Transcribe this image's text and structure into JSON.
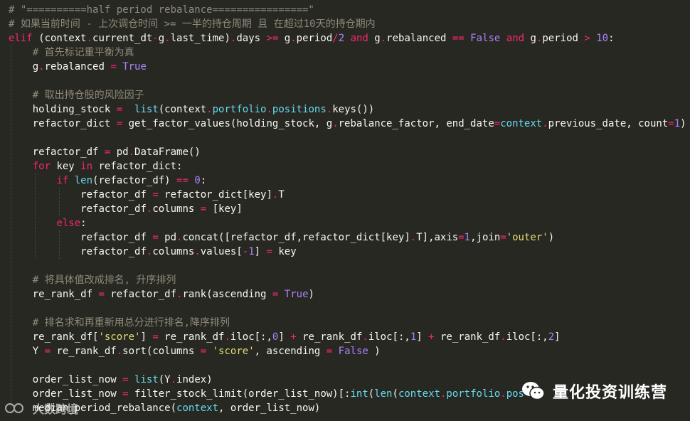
{
  "code_lines": [
    {
      "indent": "",
      "tokens": [
        {
          "c": "cm",
          "t": "# \"==========half period rebalance================\""
        }
      ]
    },
    {
      "indent": "",
      "tokens": [
        {
          "c": "cm",
          "t": "# 如果当前时间 - 上次调仓时间 >= 一半的持仓周期 且 在超过10天的持仓期内"
        }
      ]
    },
    {
      "indent": "",
      "tokens": [
        {
          "c": "kw",
          "t": "elif"
        },
        {
          "c": "tx",
          "t": " (context"
        },
        {
          "c": "op",
          "t": "."
        },
        {
          "c": "tx",
          "t": "current_dt"
        },
        {
          "c": "op",
          "t": "-"
        },
        {
          "c": "tx",
          "t": "g"
        },
        {
          "c": "op",
          "t": "."
        },
        {
          "c": "tx",
          "t": "last_time)"
        },
        {
          "c": "op",
          "t": "."
        },
        {
          "c": "tx",
          "t": "days "
        },
        {
          "c": "op",
          "t": ">="
        },
        {
          "c": "tx",
          "t": " g"
        },
        {
          "c": "op",
          "t": "."
        },
        {
          "c": "tx",
          "t": "period"
        },
        {
          "c": "op",
          "t": "/"
        },
        {
          "c": "nm",
          "t": "2"
        },
        {
          "c": "tx",
          "t": " "
        },
        {
          "c": "kw",
          "t": "and"
        },
        {
          "c": "tx",
          "t": " g"
        },
        {
          "c": "op",
          "t": "."
        },
        {
          "c": "tx",
          "t": "rebalanced "
        },
        {
          "c": "op",
          "t": "=="
        },
        {
          "c": "tx",
          "t": " "
        },
        {
          "c": "cn",
          "t": "False"
        },
        {
          "c": "tx",
          "t": " "
        },
        {
          "c": "kw",
          "t": "and"
        },
        {
          "c": "tx",
          "t": " g"
        },
        {
          "c": "op",
          "t": "."
        },
        {
          "c": "tx",
          "t": "period "
        },
        {
          "c": "op",
          "t": ">"
        },
        {
          "c": "tx",
          "t": " "
        },
        {
          "c": "nm",
          "t": "10"
        },
        {
          "c": "tx",
          "t": ":"
        }
      ]
    },
    {
      "indent": "    ",
      "tokens": [
        {
          "c": "cm",
          "t": "# 首先标记重平衡为真"
        }
      ]
    },
    {
      "indent": "    ",
      "tokens": [
        {
          "c": "tx",
          "t": "g"
        },
        {
          "c": "op",
          "t": "."
        },
        {
          "c": "tx",
          "t": "rebalanced "
        },
        {
          "c": "op",
          "t": "="
        },
        {
          "c": "tx",
          "t": " "
        },
        {
          "c": "cn",
          "t": "True"
        }
      ]
    },
    {
      "indent": "",
      "tokens": []
    },
    {
      "indent": "    ",
      "tokens": [
        {
          "c": "cm",
          "t": "# 取出持仓股的风险因子"
        }
      ]
    },
    {
      "indent": "    ",
      "tokens": [
        {
          "c": "tx",
          "t": "holding_stock "
        },
        {
          "c": "op",
          "t": "="
        },
        {
          "c": "tx",
          "t": "  "
        },
        {
          "c": "bi",
          "t": "list"
        },
        {
          "c": "tx",
          "t": "(context"
        },
        {
          "c": "op",
          "t": "."
        },
        {
          "c": "bi",
          "t": "portfolio"
        },
        {
          "c": "op",
          "t": "."
        },
        {
          "c": "bi",
          "t": "positions"
        },
        {
          "c": "op",
          "t": "."
        },
        {
          "c": "tx",
          "t": "keys())"
        }
      ]
    },
    {
      "indent": "    ",
      "tokens": [
        {
          "c": "tx",
          "t": "refactor_dict "
        },
        {
          "c": "op",
          "t": "="
        },
        {
          "c": "tx",
          "t": " get_factor_values(holding_stock, g"
        },
        {
          "c": "op",
          "t": "."
        },
        {
          "c": "tx",
          "t": "rebalance_factor, end_date"
        },
        {
          "c": "op",
          "t": "="
        },
        {
          "c": "bi",
          "t": "context"
        },
        {
          "c": "op",
          "t": "."
        },
        {
          "c": "tx",
          "t": "previous_date, count"
        },
        {
          "c": "op",
          "t": "="
        },
        {
          "c": "nm",
          "t": "1"
        },
        {
          "c": "tx",
          "t": ")"
        }
      ]
    },
    {
      "indent": "",
      "tokens": []
    },
    {
      "indent": "    ",
      "tokens": [
        {
          "c": "tx",
          "t": "refactor_df "
        },
        {
          "c": "op",
          "t": "="
        },
        {
          "c": "tx",
          "t": " pd"
        },
        {
          "c": "op",
          "t": "."
        },
        {
          "c": "tx",
          "t": "DataFrame()"
        }
      ]
    },
    {
      "indent": "    ",
      "tokens": [
        {
          "c": "kw",
          "t": "for"
        },
        {
          "c": "tx",
          "t": " key "
        },
        {
          "c": "kw",
          "t": "in"
        },
        {
          "c": "tx",
          "t": " refactor_dict:"
        }
      ]
    },
    {
      "indent": "        ",
      "tokens": [
        {
          "c": "kw",
          "t": "if"
        },
        {
          "c": "tx",
          "t": " "
        },
        {
          "c": "bi",
          "t": "len"
        },
        {
          "c": "tx",
          "t": "(refactor_df) "
        },
        {
          "c": "op",
          "t": "=="
        },
        {
          "c": "tx",
          "t": " "
        },
        {
          "c": "nm",
          "t": "0"
        },
        {
          "c": "tx",
          "t": ":"
        }
      ]
    },
    {
      "indent": "            ",
      "tokens": [
        {
          "c": "tx",
          "t": "refactor_df "
        },
        {
          "c": "op",
          "t": "="
        },
        {
          "c": "tx",
          "t": " refactor_dict[key]"
        },
        {
          "c": "op",
          "t": "."
        },
        {
          "c": "tx",
          "t": "T"
        }
      ]
    },
    {
      "indent": "            ",
      "tokens": [
        {
          "c": "tx",
          "t": "refactor_df"
        },
        {
          "c": "op",
          "t": "."
        },
        {
          "c": "tx",
          "t": "columns "
        },
        {
          "c": "op",
          "t": "="
        },
        {
          "c": "tx",
          "t": " [key]"
        }
      ]
    },
    {
      "indent": "        ",
      "tokens": [
        {
          "c": "kw",
          "t": "else"
        },
        {
          "c": "tx",
          "t": ":"
        }
      ]
    },
    {
      "indent": "            ",
      "tokens": [
        {
          "c": "tx",
          "t": "refactor_df "
        },
        {
          "c": "op",
          "t": "="
        },
        {
          "c": "tx",
          "t": " pd"
        },
        {
          "c": "op",
          "t": "."
        },
        {
          "c": "tx",
          "t": "concat([refactor_df,refactor_dict[key]"
        },
        {
          "c": "op",
          "t": "."
        },
        {
          "c": "tx",
          "t": "T],axis"
        },
        {
          "c": "op",
          "t": "="
        },
        {
          "c": "nm",
          "t": "1"
        },
        {
          "c": "tx",
          "t": ",join"
        },
        {
          "c": "op",
          "t": "="
        },
        {
          "c": "st",
          "t": "'outer'"
        },
        {
          "c": "tx",
          "t": ")"
        }
      ]
    },
    {
      "indent": "            ",
      "tokens": [
        {
          "c": "tx",
          "t": "refactor_df"
        },
        {
          "c": "op",
          "t": "."
        },
        {
          "c": "tx",
          "t": "columns"
        },
        {
          "c": "op",
          "t": "."
        },
        {
          "c": "tx",
          "t": "values["
        },
        {
          "c": "op",
          "t": "-"
        },
        {
          "c": "nm",
          "t": "1"
        },
        {
          "c": "tx",
          "t": "] "
        },
        {
          "c": "op",
          "t": "="
        },
        {
          "c": "tx",
          "t": " key"
        }
      ]
    },
    {
      "indent": "",
      "tokens": []
    },
    {
      "indent": "    ",
      "tokens": [
        {
          "c": "cm",
          "t": "# 将具体值改成排名, 升序排列"
        }
      ]
    },
    {
      "indent": "    ",
      "tokens": [
        {
          "c": "tx",
          "t": "re_rank_df "
        },
        {
          "c": "op",
          "t": "="
        },
        {
          "c": "tx",
          "t": " refactor_df"
        },
        {
          "c": "op",
          "t": "."
        },
        {
          "c": "tx",
          "t": "rank(ascending "
        },
        {
          "c": "op",
          "t": "="
        },
        {
          "c": "tx",
          "t": " "
        },
        {
          "c": "cn",
          "t": "True"
        },
        {
          "c": "tx",
          "t": ")"
        }
      ]
    },
    {
      "indent": "",
      "tokens": []
    },
    {
      "indent": "    ",
      "tokens": [
        {
          "c": "cm",
          "t": "# 排名求和再重新用总分进行排名,降序排列"
        }
      ]
    },
    {
      "indent": "    ",
      "tokens": [
        {
          "c": "tx",
          "t": "re_rank_df["
        },
        {
          "c": "st",
          "t": "'score'"
        },
        {
          "c": "tx",
          "t": "] "
        },
        {
          "c": "op",
          "t": "="
        },
        {
          "c": "tx",
          "t": " re_rank_df"
        },
        {
          "c": "op",
          "t": "."
        },
        {
          "c": "tx",
          "t": "iloc[:,"
        },
        {
          "c": "nm",
          "t": "0"
        },
        {
          "c": "tx",
          "t": "] "
        },
        {
          "c": "op",
          "t": "+"
        },
        {
          "c": "tx",
          "t": " re_rank_df"
        },
        {
          "c": "op",
          "t": "."
        },
        {
          "c": "tx",
          "t": "iloc[:,"
        },
        {
          "c": "nm",
          "t": "1"
        },
        {
          "c": "tx",
          "t": "] "
        },
        {
          "c": "op",
          "t": "+"
        },
        {
          "c": "tx",
          "t": " re_rank_df"
        },
        {
          "c": "op",
          "t": "."
        },
        {
          "c": "tx",
          "t": "iloc[:,"
        },
        {
          "c": "nm",
          "t": "2"
        },
        {
          "c": "tx",
          "t": "]"
        }
      ]
    },
    {
      "indent": "    ",
      "tokens": [
        {
          "c": "tx",
          "t": "Y "
        },
        {
          "c": "op",
          "t": "="
        },
        {
          "c": "tx",
          "t": " re_rank_df"
        },
        {
          "c": "op",
          "t": "."
        },
        {
          "c": "tx",
          "t": "sort(columns "
        },
        {
          "c": "op",
          "t": "="
        },
        {
          "c": "tx",
          "t": " "
        },
        {
          "c": "st",
          "t": "'score'"
        },
        {
          "c": "tx",
          "t": ", ascending "
        },
        {
          "c": "op",
          "t": "="
        },
        {
          "c": "tx",
          "t": " "
        },
        {
          "c": "cn",
          "t": "False"
        },
        {
          "c": "tx",
          "t": " )"
        }
      ]
    },
    {
      "indent": "",
      "tokens": []
    },
    {
      "indent": "    ",
      "tokens": [
        {
          "c": "tx",
          "t": "order_list_now "
        },
        {
          "c": "op",
          "t": "="
        },
        {
          "c": "tx",
          "t": " "
        },
        {
          "c": "bi",
          "t": "list"
        },
        {
          "c": "tx",
          "t": "(Y"
        },
        {
          "c": "op",
          "t": "."
        },
        {
          "c": "tx",
          "t": "index)"
        }
      ]
    },
    {
      "indent": "    ",
      "tokens": [
        {
          "c": "tx",
          "t": "order_list_now "
        },
        {
          "c": "op",
          "t": "="
        },
        {
          "c": "tx",
          "t": " filter_stock_limit(order_list_now)[:"
        },
        {
          "c": "bi",
          "t": "int"
        },
        {
          "c": "tx",
          "t": "("
        },
        {
          "c": "bi",
          "t": "len"
        },
        {
          "c": "tx",
          "t": "("
        },
        {
          "c": "bi",
          "t": "context"
        },
        {
          "c": "op",
          "t": "."
        },
        {
          "c": "bi",
          "t": "portfolio"
        },
        {
          "c": "op",
          "t": "."
        },
        {
          "c": "bi",
          "t": "pos"
        }
      ]
    },
    {
      "indent": "    ",
      "tokens": [
        {
          "c": "tx",
          "t": "median_period_rebalance("
        },
        {
          "c": "bi",
          "t": "context"
        },
        {
          "c": "tx",
          "t": ", order_list_now)"
        }
      ]
    }
  ],
  "watermarks": {
    "wechat_text": "量化投资训练营",
    "csdn_text": "大数跨境",
    "wechat_icon": "wechat-icon",
    "csdn_icon": "csdn-logo"
  },
  "colors": {
    "background": "#272822",
    "comment": "#908a7a",
    "keyword": "#f92672",
    "builtin": "#66d9ef",
    "number": "#ae81ff",
    "string": "#e6db74",
    "text": "#f8f8f2"
  }
}
